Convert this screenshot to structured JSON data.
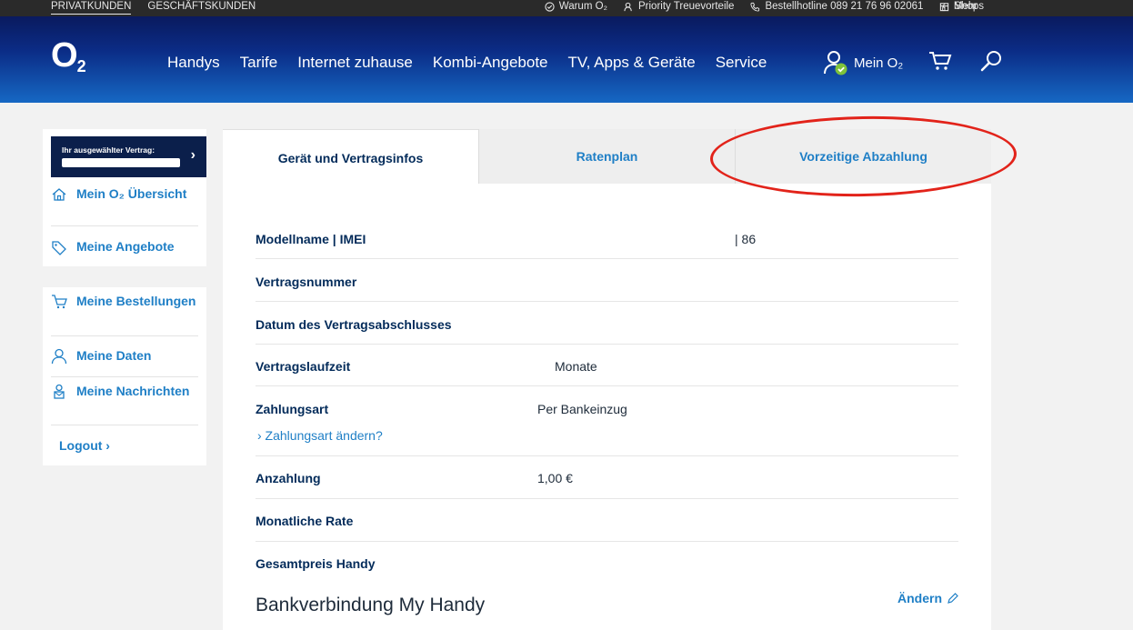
{
  "topbar": {
    "segments": [
      "PRIVATKUNDEN",
      "GESCHÄFTSKUNDEN"
    ],
    "links": [
      "Warum O₂",
      "Priority Treuevorteile",
      "Bestellhotline 089 21 76 96 02061",
      "Shops"
    ],
    "more": "Mehr"
  },
  "header": {
    "logo": "O",
    "logo_sub": "2",
    "nav": [
      "Handys",
      "Tarife",
      "Internet zuhause",
      "Kombi-Angebote",
      "TV, Apps & Geräte",
      "Service"
    ],
    "account_label": "Mein O₂"
  },
  "sidebar": {
    "contract_label": "Ihr ausgewählter Vertrag:",
    "items_top": [
      {
        "label": "Mein O₂ Übersicht",
        "icon": "home-icon"
      },
      {
        "label": "Meine Angebote",
        "icon": "tag-icon"
      }
    ],
    "items_bottom": [
      {
        "label": "Meine Bestellungen",
        "icon": "cart-icon"
      },
      {
        "label": "Meine Daten",
        "icon": "user-icon"
      },
      {
        "label": "Meine Nachrichten",
        "icon": "message-icon"
      }
    ],
    "logout": "Logout ›"
  },
  "tabs": [
    {
      "label": "Gerät und Vertragsinfos",
      "active": true
    },
    {
      "label": "Ratenplan",
      "active": false
    },
    {
      "label": "Vorzeitige Abzahlung",
      "active": false
    }
  ],
  "details": [
    {
      "key": "Modellname | IMEI",
      "value": "| 86"
    },
    {
      "key": "Vertragsnummer",
      "value": ""
    },
    {
      "key": "Datum des Vertragsabschlusses",
      "value": ""
    },
    {
      "key": "Vertragslaufzeit",
      "value": "Monate"
    },
    {
      "key": "Zahlungsart",
      "value": "Per Bankeinzug"
    },
    {
      "key": "Anzahlung",
      "value": "1,00 €"
    },
    {
      "key": "Monatliche Rate",
      "value": ""
    },
    {
      "key": "Gesamtpreis Handy",
      "value": ""
    }
  ],
  "change_payment": "› Zahlungsart ändern?",
  "bank_heading": "Bankverbindung My Handy",
  "edit_label": "Ändern",
  "colors": {
    "accent": "#1f7fc6",
    "navy": "#032b5a",
    "highlight": "#e2231a"
  }
}
